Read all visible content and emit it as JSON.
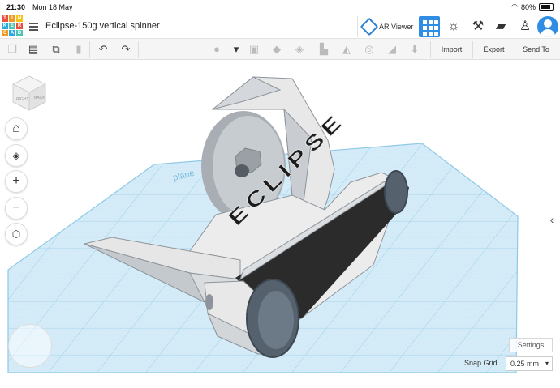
{
  "status_bar": {
    "time": "21:30",
    "date": "Mon 18 May",
    "battery": "80%"
  },
  "logo": {
    "letters": [
      "T",
      "I",
      "N",
      "K",
      "E",
      "R",
      "C",
      "A",
      "D"
    ]
  },
  "header": {
    "design_title": "Eclipse-150g vertical spinner",
    "ar_viewer_label": "AR Viewer"
  },
  "toolbar": {
    "import_label": "Import",
    "export_label": "Export",
    "send_to_label": "Send To"
  },
  "workplane": {
    "label": "plane"
  },
  "robot": {
    "label": "ECLIPSE"
  },
  "viewcube": {
    "front": "RIGHT",
    "side": "BACK"
  },
  "footer": {
    "settings_label": "Settings",
    "snap_grid_label": "Snap Grid",
    "snap_grid_value": "0.25 mm"
  },
  "colors": {
    "accent": "#2f8de4",
    "grid": "#cfe9f6",
    "grid_line": "#a9d6ec",
    "robot_body": "#e6e6e6",
    "robot_shade": "#9aa0a6",
    "track": "#2b2b2b",
    "wheel": "#5a6a7a"
  },
  "icons": [
    "menu-icon",
    "ar-viewer-icon",
    "grid-view-icon",
    "blocks-icon",
    "pickaxe-icon",
    "bricks-icon",
    "add-user-icon",
    "copy-icon",
    "paste-icon",
    "duplicate-icon",
    "trash-icon",
    "undo-icon",
    "redo-icon",
    "bulb-icon",
    "shape-icon",
    "group-icon",
    "ungroup-icon",
    "align-icon",
    "mirror-icon",
    "workplane-icon",
    "ruler-icon",
    "drop-icon",
    "home-icon",
    "fit-view-icon",
    "zoom-in-icon",
    "zoom-out-icon",
    "perspective-icon",
    "chevron-left-icon"
  ]
}
